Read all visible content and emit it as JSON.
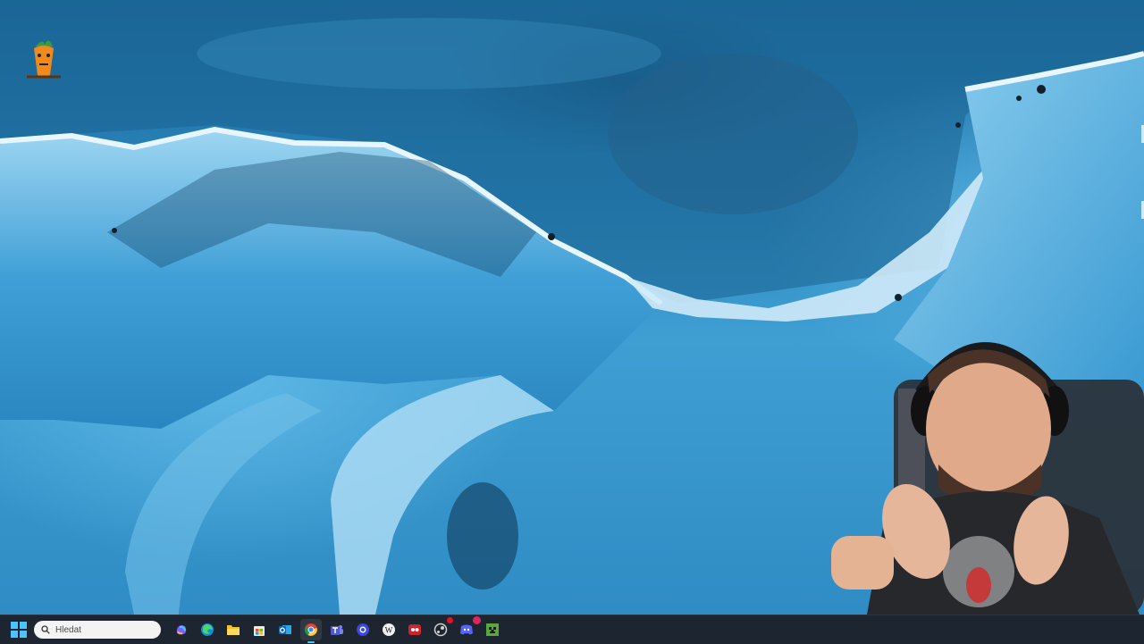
{
  "desktop": {
    "wallpaper": "glacier-ice-wallpaper",
    "icons": [
      {
        "name": "carrot-mascot-icon",
        "label": ""
      }
    ]
  },
  "webcam": {
    "name": "streamer-webcam-overlay"
  },
  "taskbar": {
    "start": {
      "icon": "windows-start-icon"
    },
    "search": {
      "placeholder": "Hledat",
      "icon": "search-icon"
    },
    "apps": [
      {
        "name": "copilot-icon"
      },
      {
        "name": "edge-browser-icon"
      },
      {
        "name": "file-explorer-icon"
      },
      {
        "name": "microsoft-store-icon"
      },
      {
        "name": "outlook-icon"
      },
      {
        "name": "chrome-browser-icon",
        "active": true
      },
      {
        "name": "teams-icon"
      },
      {
        "name": "blue-circle-app-icon"
      },
      {
        "name": "wikipedia-app-icon"
      },
      {
        "name": "red-app-icon"
      },
      {
        "name": "steam-like-icon"
      },
      {
        "name": "discord-icon"
      },
      {
        "name": "minecraft-icon"
      }
    ],
    "badges": {
      "discord": ""
    }
  },
  "colors": {
    "taskbar_bg": "#1c2530",
    "accent": "#4cc2ff",
    "ice_light": "#cfeaf8",
    "ice_mid": "#3f9fd3",
    "ice_dark": "#0f4a74"
  }
}
